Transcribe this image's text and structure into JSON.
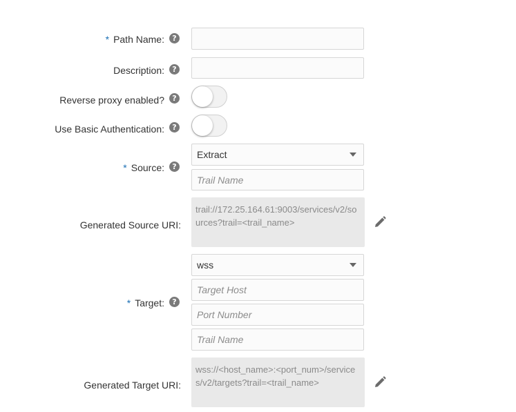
{
  "form": {
    "path_name": {
      "label": "Path Name:",
      "required_marker": "*",
      "help": "?",
      "value": ""
    },
    "description": {
      "label": "Description:",
      "help": "?",
      "value": ""
    },
    "reverse_proxy": {
      "label": "Reverse proxy enabled?",
      "help": "?",
      "enabled": false
    },
    "basic_auth": {
      "label": "Use Basic Authentication:",
      "help": "?",
      "enabled": false
    },
    "source": {
      "label": "Source:",
      "required_marker": "*",
      "help": "?",
      "selected": "Extract",
      "trail_placeholder": "Trail Name"
    },
    "generated_source_uri": {
      "label": "Generated Source URI:",
      "value": "trail://172.25.164.61:9003/services/v2/sources?trail=<trail_name>",
      "edit_icon": "pencil-icon"
    },
    "target": {
      "label": "Target:",
      "required_marker": "*",
      "help": "?",
      "selected": "wss",
      "host_placeholder": "Target Host",
      "port_placeholder": "Port Number",
      "trail_placeholder": "Trail Name"
    },
    "generated_target_uri": {
      "label": "Generated Target URI:",
      "value": "wss://<host_name>:<port_num>/services/v2/targets?trail=<trail_name>",
      "edit_icon": "pencil-icon"
    }
  },
  "colors": {
    "required": "#1a6fb4",
    "help_icon": "#7a7a7a",
    "readonly_bg": "#e9e9e9"
  }
}
